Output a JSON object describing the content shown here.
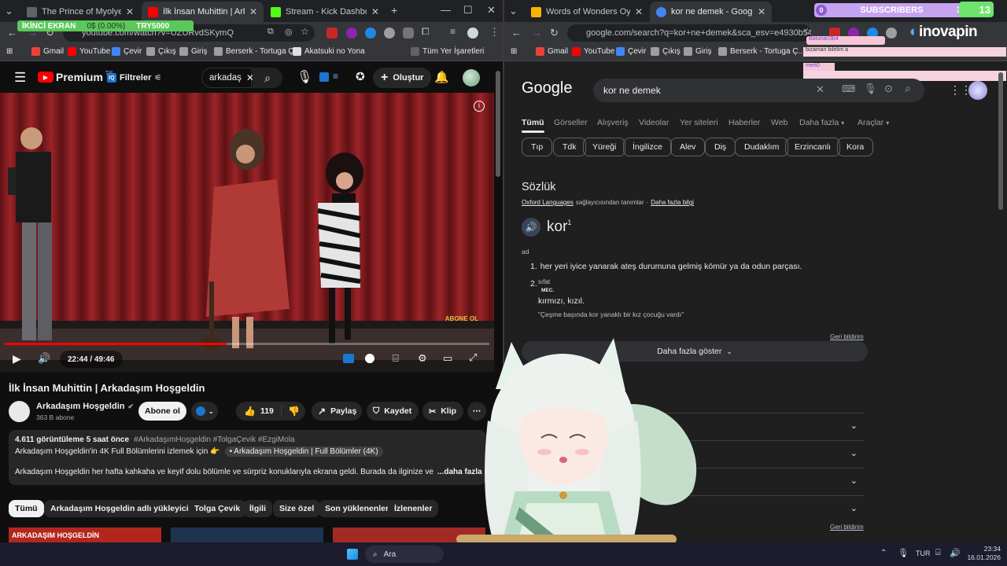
{
  "left_window": {
    "tabs": [
      {
        "title": "The Prince of Myolyeong - Bölü",
        "active": false
      },
      {
        "title": "İlk İnsan Muhittin | Arkadaşım",
        "active": true
      },
      {
        "title": "Stream - Kick Dashboard",
        "active": false
      }
    ],
    "url": "youtube.com/watch?v=UZURvdSKymQ",
    "overlay": {
      "label": "İKİNCİ EKRAN",
      "progress": "0$ (0.00%)",
      "goal": "TRY5000"
    },
    "bookmarks": [
      "Gmail",
      "YouTube",
      "Çevir",
      "Çıkış",
      "Giriş",
      "Berserk - Tortuga Ç...",
      "Akatsuki no Yona",
      "Tüm Yer İşaretleri"
    ],
    "youtube": {
      "logo": "Premium",
      "logo_region": "TR",
      "filter_label": "Filtreler",
      "search_value": "arkadaş",
      "create_label": "Oluştur",
      "time": "22:44 / 49:46",
      "progress_fraction": 0.457,
      "watermark": "ABONE OL",
      "title": "İlk İnsan Muhittin | Arkadaşım Hoşgeldin",
      "channel": "Arkadaşım Hoşgeldin",
      "subs": "363 B abone",
      "subscribe": "Abone ol",
      "likes": "119",
      "share": "Paylaş",
      "save": "Kaydet",
      "clip": "Klip",
      "desc_stats": "4.611 görüntüleme  5 saat önce",
      "desc_tags": "#ArkadaşımHoşgeldin #TolgaÇevik #EzgiMola",
      "desc_line2a": "Arkadaşım Hoşgeldin'in 4K Full Bölümlerini izlemek için 👉",
      "desc_line2b": "• Arkadaşım Hoşgeldin | Full Bölümler (4K)",
      "desc_line3": "Arkadaşım Hoşgeldin her hafta kahkaha ve keyif dolu bölümle ve sürpriz konuklarıyla ekrana geldi. Burada da ilginize ve beğeniniz",
      "more": "...daha fazla",
      "chips": [
        "Tümü",
        "Arkadaşım Hoşgeldin adlı yükleyiciden",
        "Tolga Çevik",
        "İlgili",
        "Size özel",
        "Son yüklenenler",
        "İzlenenler"
      ],
      "thumb_text": "ARKADAŞIM HOŞGELDİN"
    }
  },
  "right_window": {
    "tabs": [
      {
        "title": "Words of Wonders Oyunu - On",
        "active": false
      },
      {
        "title": "kor ne demek - Google'da Ara",
        "active": true
      }
    ],
    "url": "google.com/search?q=kor+ne+demek&sca_esv=e4930b54a8b...",
    "subscribers": {
      "count_left": "0",
      "label": "SUBSCRIBERS",
      "count_right": "3",
      "badge": "13"
    },
    "brand": "inovapin",
    "chat": [
      {
        "user": "Batuhan3b4",
        "msg": "bizaman bilelim a"
      },
      {
        "user": "mert0",
        "msg": ""
      }
    ],
    "bookmarks": [
      "Gmail",
      "YouTube",
      "Çevir",
      "Çıkış",
      "Giriş",
      "Berserk - Tortuga Ç..."
    ],
    "google": {
      "logo": "Google",
      "query": "kor ne demek",
      "tabs": [
        "Tümü",
        "Görseller",
        "Alışveriş",
        "Videolar",
        "Yer siteleri",
        "Haberler",
        "Web",
        "Daha fazla",
        "Araçlar"
      ],
      "chips": [
        "Tıp",
        "Tdk",
        "Yüreği",
        "İngilizce",
        "Alev",
        "Diş",
        "Dudaklım",
        "Erzincanlı",
        "Kora"
      ],
      "dict_heading": "Sözlük",
      "source_a": "Oxford Languages",
      "source_b": "sağlayıcısından tanımlar",
      "source_sep": "·",
      "source_link": "Daha fazla bilgi",
      "word": "kor",
      "word_sup": "1",
      "pos": "ad",
      "def1_num": "1.",
      "def1": "her yeri iyice yanarak ateş durumuna gelmiş kömür ya da odun parçası.",
      "def2_num": "2.",
      "def2_pos": "sıfat",
      "def2_tag": "MEC.",
      "def2": "kırmızı, kızıl.",
      "def2_example": "\"Çeşme başında kor yanaklı bir kız çocuğu vardı\"",
      "feedback": "Geri bildirim",
      "show_more": "Daha fazla göster",
      "feedback2": "Geri bildirim"
    }
  },
  "taskbar": {
    "search": "Ara",
    "lang": "TUR",
    "time": "23:34",
    "date": "16.01.2026"
  },
  "colors": {
    "yt_red": "#ff0000",
    "google_blue": "#8ab4f8",
    "kick_green": "#53fc18"
  }
}
